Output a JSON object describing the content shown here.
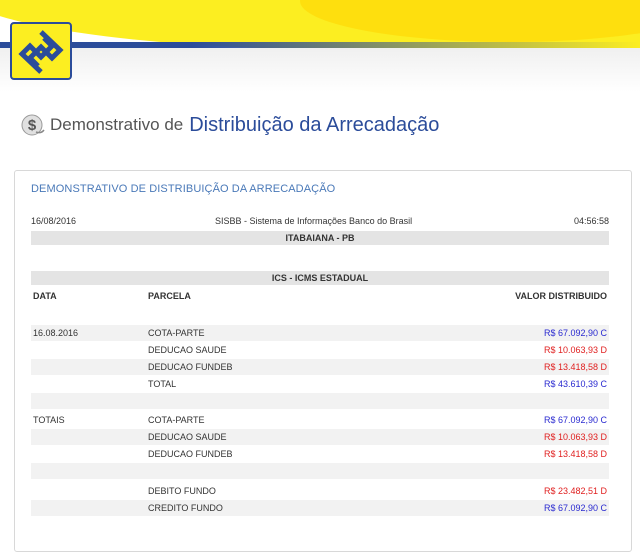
{
  "page": {
    "title_prefix": "Demonstrativo de",
    "title_main": "Distribuição da Arrecadação"
  },
  "panel": {
    "title": "DEMONSTRATIVO DE DISTRIBUIÇÃO DA ARRECADAÇÃO",
    "date": "16/08/2016",
    "system": "SISBB - Sistema de Informações Banco do Brasil",
    "time": "04:56:58",
    "municipality": "ITABAIANA - PB",
    "tax": "ICS - ICMS ESTADUAL"
  },
  "columns": {
    "data": "DATA",
    "parcela": "PARCELA",
    "valor": "VALOR DISTRIBUIDO"
  },
  "rows": [
    {
      "data": "16.08.2016",
      "parcela": "COTA-PARTE",
      "valor": "R$ 67.092,90 C",
      "kind": "credit"
    },
    {
      "data": "",
      "parcela": "DEDUCAO SAUDE",
      "valor": "R$ 10.063,93 D",
      "kind": "debit"
    },
    {
      "data": "",
      "parcela": "DEDUCAO FUNDEB",
      "valor": "R$ 13.418,58 D",
      "kind": "debit"
    },
    {
      "data": "",
      "parcela": "TOTAL",
      "valor": "R$ 43.610,39 C",
      "kind": "credit"
    },
    {
      "data": "TOTAIS",
      "parcela": "COTA-PARTE",
      "valor": "R$ 67.092,90 C",
      "kind": "credit"
    },
    {
      "data": "",
      "parcela": "DEDUCAO SAUDE",
      "valor": "R$ 10.063,93 D",
      "kind": "debit"
    },
    {
      "data": "",
      "parcela": "DEDUCAO FUNDEB",
      "valor": "R$ 13.418,58 D",
      "kind": "debit"
    },
    {
      "data": "",
      "parcela": "DEBITO FUNDO",
      "valor": "R$ 23.482,51 D",
      "kind": "debit"
    },
    {
      "data": "",
      "parcela": "CREDITO FUNDO",
      "valor": "R$ 67.092,90 C",
      "kind": "credit"
    }
  ],
  "colors": {
    "brand_blue": "#2b4c9a",
    "brand_yellow": "#fcee21",
    "credit": "#2a2ad0",
    "debit": "#e02020"
  }
}
